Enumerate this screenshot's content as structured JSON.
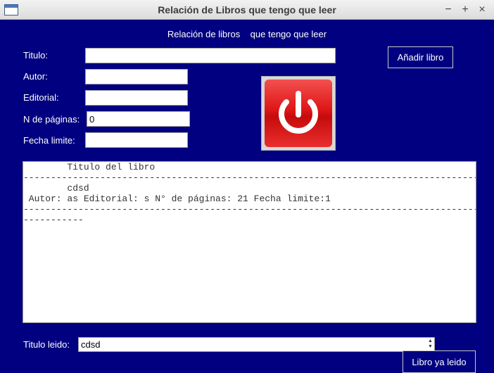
{
  "window": {
    "title": "Relación de Libros que tengo que leer"
  },
  "header": {
    "text": "Relación de libros    que tengo que leer"
  },
  "form": {
    "titulo_label": "Titulo:",
    "autor_label": "Autor:",
    "editorial_label": "Editorial:",
    "paginas_label": "N de páginas:",
    "paginas_value": "0",
    "fecha_label": "Fecha limite:"
  },
  "buttons": {
    "add_book": "Añadir libro",
    "book_read": "Libro ya leido"
  },
  "list": {
    "lines": [
      "        Titulo del libro",
      "---------------------------------------------------------------------------------------",
      "        cdsd",
      " Autor: as Editorial: s N° de páginas: 21 Fecha limite:1",
      "---------------------------------------------------------------------------------------",
      "-----------"
    ]
  },
  "bottom": {
    "label": "Titulo leido:",
    "selected": "cdsd"
  },
  "icons": {
    "app": "window-icon",
    "power": "power-icon"
  }
}
